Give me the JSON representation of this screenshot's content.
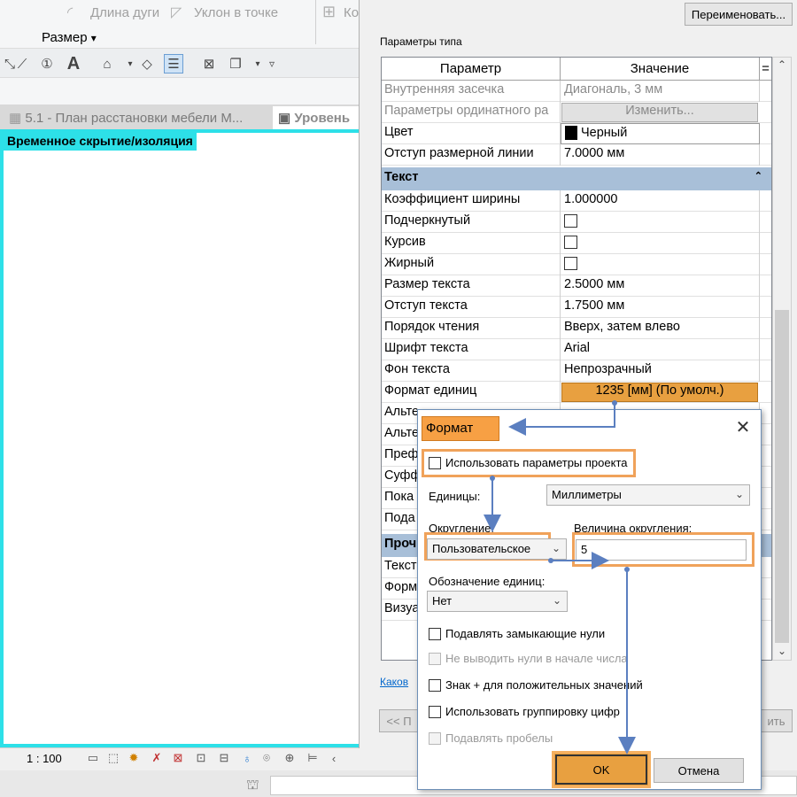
{
  "ribbon": {
    "arc_length": "Длина дуги",
    "slope_at_point": "Уклон  в точке",
    "truncated": "Ко",
    "dimension_label": "Размер",
    "dimension_arrow": "▾"
  },
  "tabs": [
    {
      "label": "5.1 - План расстановки мебели М..."
    },
    {
      "label": "Уровень"
    }
  ],
  "view": {
    "temp_hide_label": "Временное скрытие/изоляция"
  },
  "statusbar": {
    "scale": "1 : 100"
  },
  "type_dialog": {
    "rename_button": "Переименовать...",
    "type_params_label": "Параметры типа",
    "col_param": "Параметр",
    "col_value": "Значение",
    "col_eq": "=",
    "rows_top": [
      {
        "param": "Внутренняя засечка",
        "value": "Диагональ, 3 мм",
        "grey": true
      },
      {
        "param": "Параметры ординатного ра",
        "value": "Изменить...",
        "grey": true,
        "button": true
      },
      {
        "param": "Цвет",
        "value": "Черный",
        "swatch": "#000000"
      },
      {
        "param": "Отступ размерной линии",
        "value": "7.0000 мм"
      }
    ],
    "group_text": "Текст",
    "collapse_glyph": "⌃",
    "rows_text": [
      {
        "param": "Коэффициент ширины",
        "value": "1.000000"
      },
      {
        "param": "Подчеркнутый",
        "value": "",
        "checkbox": true
      },
      {
        "param": "Курсив",
        "value": "",
        "checkbox": true
      },
      {
        "param": "Жирный",
        "value": "",
        "checkbox": true
      },
      {
        "param": "Размер текста",
        "value": "2.5000 мм"
      },
      {
        "param": "Отступ текста",
        "value": "1.7500 мм"
      },
      {
        "param": "Порядок чтения",
        "value": "Вверх, затем влево"
      },
      {
        "param": "Шрифт текста",
        "value": "Arial"
      },
      {
        "param": "Фон текста",
        "value": "Непрозрачный"
      },
      {
        "param": "Формат единиц",
        "value": "1235 [мм] (По умолч.)",
        "button": true,
        "orange": true
      },
      {
        "param": "Альте",
        "value": ""
      },
      {
        "param": "Альте",
        "value": ""
      },
      {
        "param": "Преф",
        "value": ""
      },
      {
        "param": "Суфф",
        "value": ""
      },
      {
        "param": "Пока",
        "value": ""
      },
      {
        "param": "Пода",
        "value": ""
      }
    ],
    "group_other": "Проч",
    "rows_other": [
      {
        "param": "Текст",
        "value": ""
      },
      {
        "param": "Форм",
        "value": ""
      },
      {
        "param": "Визуа",
        "value": ""
      }
    ],
    "preview_link": "Кaков",
    "prev_button": "<< П",
    "apply_button": "ить"
  },
  "format_dialog": {
    "title": "Формат",
    "close_glyph": "✕",
    "use_project_settings": "Использовать параметры проекта",
    "units_label": "Единицы:",
    "units_value": "Миллиметры",
    "rounding_label": "Округление:",
    "rounding_value": "Пользовательское",
    "rounding_increment_label": "Величина округления:",
    "rounding_increment_value": "5",
    "unit_symbol_label": "Обозначение единиц:",
    "unit_symbol_value": "Нет",
    "suppress_trailing_zeros": "Подавлять замыкающие нули",
    "suppress_leading_zeros": "Не выводить нули в начале числа",
    "plus_sign": "Знак + для положительных значений",
    "digit_grouping": "Использовать группировку цифр",
    "suppress_spaces": "Подавлять пробелы",
    "ok": "OK",
    "cancel": "Отмена"
  },
  "colors": {
    "accent_cyan": "#2de0e8",
    "highlight_orange": "#f0a25a",
    "group_header": "#a8bfd8",
    "arrow_blue": "#5b7fc0"
  }
}
